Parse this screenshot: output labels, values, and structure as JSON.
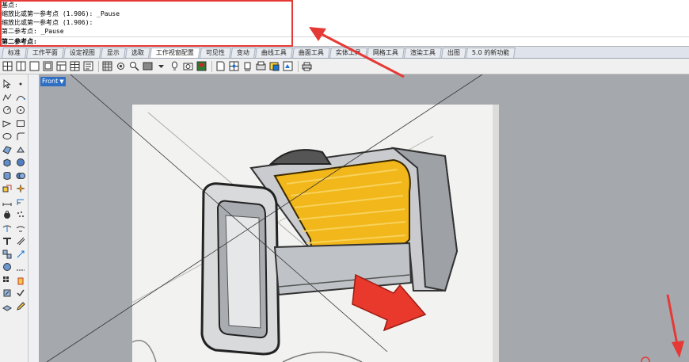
{
  "command_history": {
    "lines": [
      "基点:",
      "缩放比或第一参考点 (1.906): _Pause",
      "缩放比或第一参考点 (1.906):",
      "第二参考点: _Pause"
    ],
    "prompt": "第二参考点:"
  },
  "tabs": [
    {
      "label": "标准",
      "active": false
    },
    {
      "label": "工作平面",
      "active": false
    },
    {
      "label": "设定视图",
      "active": false
    },
    {
      "label": "显示",
      "active": false
    },
    {
      "label": "选取",
      "active": false
    },
    {
      "label": "工作视窗配置",
      "active": true
    },
    {
      "label": "可见性",
      "active": false
    },
    {
      "label": "变动",
      "active": false
    },
    {
      "label": "曲线工具",
      "active": false
    },
    {
      "label": "曲面工具",
      "active": false
    },
    {
      "label": "实体工具",
      "active": false
    },
    {
      "label": "网格工具",
      "active": false
    },
    {
      "label": "渲染工具",
      "active": false
    },
    {
      "label": "出图",
      "active": false
    },
    {
      "label": "5.0 的新功能",
      "active": false
    }
  ],
  "viewport": {
    "title": "Front"
  },
  "colors": {
    "annotation": "#e53935",
    "viewport_bg": "#a5a9ae",
    "viewport_title_bg": "#2f6fc3",
    "sketch_yellow": "#f2b71a",
    "sketch_red": "#e8392c"
  }
}
